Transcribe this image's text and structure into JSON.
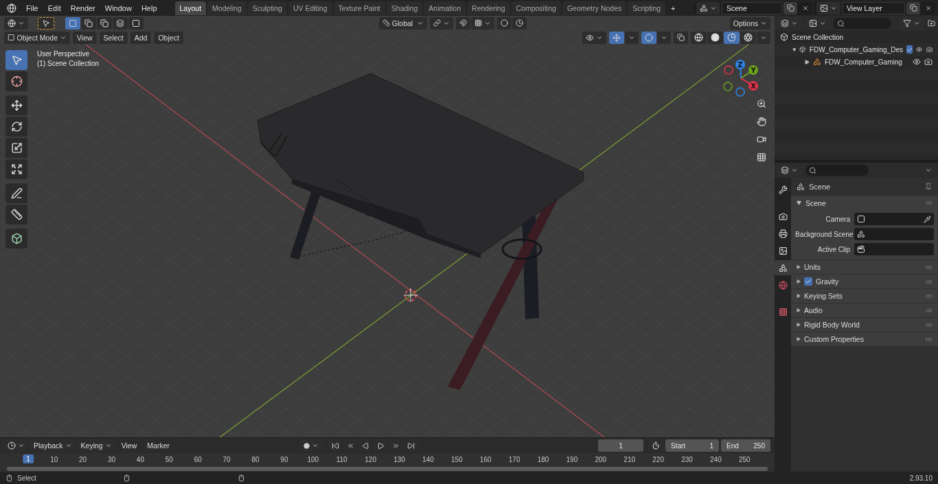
{
  "menu": [
    "File",
    "Edit",
    "Render",
    "Window",
    "Help"
  ],
  "workspace_tabs": [
    {
      "label": "Layout",
      "selected": true
    },
    {
      "label": "Modeling",
      "selected": false
    },
    {
      "label": "Sculpting",
      "selected": false
    },
    {
      "label": "UV Editing",
      "selected": false
    },
    {
      "label": "Texture Paint",
      "selected": false
    },
    {
      "label": "Shading",
      "selected": false
    },
    {
      "label": "Animation",
      "selected": false
    },
    {
      "label": "Rendering",
      "selected": false
    },
    {
      "label": "Compositing",
      "selected": false
    },
    {
      "label": "Geometry Nodes",
      "selected": false
    },
    {
      "label": "Scripting",
      "selected": false
    }
  ],
  "add_tab": "+",
  "scene_field": {
    "value": "Scene"
  },
  "view_layer_field": {
    "value": "View Layer"
  },
  "viewport": {
    "select_modes": [
      {
        "kind": "new",
        "selected": true
      },
      {
        "kind": "extend",
        "selected": false
      },
      {
        "kind": "subtract",
        "selected": false
      },
      {
        "kind": "invert",
        "selected": false
      },
      {
        "kind": "intersect",
        "selected": false
      }
    ],
    "transform_orientation": "Global",
    "options": "Options",
    "mode": "Object Mode",
    "menus": [
      "View",
      "Select",
      "Add",
      "Object"
    ],
    "overlay_text": [
      "User Perspective",
      "(1) Scene Collection"
    ],
    "shading_modes": [
      {
        "kind": "wireframe",
        "selected": false
      },
      {
        "kind": "solid",
        "selected": false
      },
      {
        "kind": "material",
        "selected": true
      },
      {
        "kind": "rendered",
        "selected": false
      }
    ],
    "tools": [
      {
        "kind": "select",
        "selected": true
      },
      {
        "kind": "cursor",
        "selected": false
      },
      {
        "kind": "move",
        "selected": false
      },
      {
        "kind": "rotate",
        "selected": false
      },
      {
        "kind": "scale",
        "selected": false
      },
      {
        "kind": "transform",
        "selected": false
      },
      {
        "kind": "annotate",
        "selected": false
      },
      {
        "kind": "measure",
        "selected": false
      },
      {
        "kind": "add_cube",
        "selected": false
      }
    ],
    "gizmo_axes": [
      {
        "label": "Z",
        "color": "#2f83e6"
      },
      {
        "label": "Y",
        "color": "#6ba31d"
      },
      {
        "label": "X",
        "color": "#e2334e"
      }
    ]
  },
  "outliner": {
    "items": [
      {
        "label": "Scene Collection",
        "children": [
          {
            "label": "FDW_Computer_Gaming_Des",
            "expanded": true,
            "checked": true,
            "children": [
              {
                "label": "FDW_Computer_Gaming",
                "expanded": false
              }
            ]
          }
        ]
      }
    ]
  },
  "properties": {
    "tabs": [
      {
        "kind": "tool",
        "selected": false
      },
      {
        "kind": "render",
        "selected": false
      },
      {
        "kind": "output",
        "selected": false
      },
      {
        "kind": "view_layer",
        "selected": false
      },
      {
        "kind": "scene",
        "selected": true
      },
      {
        "kind": "world",
        "selected": false
      },
      {
        "kind": "texture",
        "selected": false
      }
    ],
    "context": "Scene",
    "panel": {
      "title": "Scene",
      "expanded": true,
      "fields": [
        {
          "label": "Camera",
          "kind": "camera"
        },
        {
          "label": "Background Scene",
          "kind": "scene"
        },
        {
          "label": "Active Clip",
          "kind": "clip"
        }
      ]
    },
    "subpanels": [
      {
        "title": "Units",
        "kind": "plain",
        "expanded": false
      },
      {
        "title": "Gravity",
        "kind": "checkbox",
        "checked": true,
        "expanded": false
      },
      {
        "title": "Keying Sets",
        "kind": "plain",
        "expanded": false
      },
      {
        "title": "Audio",
        "kind": "plain",
        "expanded": false
      },
      {
        "title": "Rigid Body World",
        "kind": "plain",
        "expanded": false
      },
      {
        "title": "Custom Properties",
        "kind": "plain",
        "expanded": false
      }
    ]
  },
  "timeline": {
    "menus": [
      "Playback",
      "Keying",
      "View",
      "Marker"
    ],
    "current_frame": "1",
    "start_label": "Start",
    "start": "1",
    "end_label": "End",
    "end": "250",
    "playhead": "1",
    "ticks": [
      "10",
      "20",
      "30",
      "40",
      "50",
      "60",
      "70",
      "80",
      "90",
      "100",
      "110",
      "120",
      "130",
      "140",
      "150",
      "160",
      "170",
      "180",
      "190",
      "200",
      "210",
      "220",
      "230",
      "240",
      "250"
    ]
  },
  "status_bar": {
    "hint": "Select",
    "version": "2.93.10"
  }
}
